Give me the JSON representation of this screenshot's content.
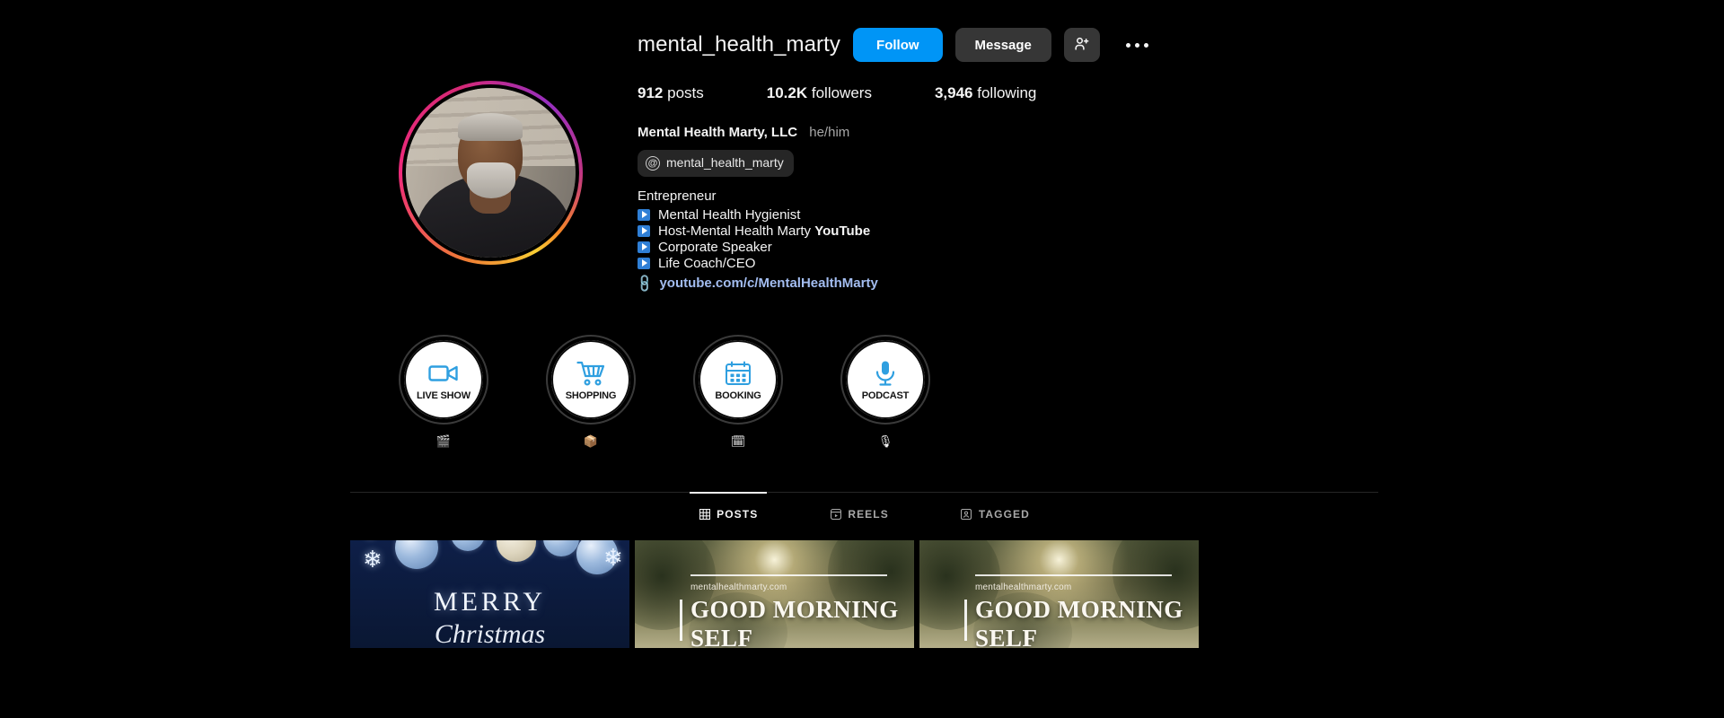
{
  "profile": {
    "username": "mental_health_marty",
    "avatar_alt": "profile-photo",
    "actions": {
      "follow_label": "Follow",
      "message_label": "Message",
      "add_person_icon": "person-add-icon",
      "more_options_icon": "more-options-icon"
    },
    "stats": [
      {
        "value": "912",
        "label": "posts"
      },
      {
        "value": "10.2K",
        "label": "followers"
      },
      {
        "value": "3,946",
        "label": "following"
      }
    ],
    "display_name": "Mental Health Marty, LLC",
    "pronouns": "he/him",
    "threads": {
      "icon": "threads-icon",
      "handle": "mental_health_marty"
    },
    "category": "Entrepreneur",
    "bio_lines": [
      {
        "icon": "play-button-emoji",
        "text": "Mental Health Hygienist",
        "bold_suffix": ""
      },
      {
        "icon": "play-button-emoji",
        "text": "Host-Mental Health Marty ",
        "bold_suffix": "YouTube"
      },
      {
        "icon": "play-button-emoji",
        "text": "Corporate Speaker",
        "bold_suffix": ""
      },
      {
        "icon": "play-button-emoji",
        "text": "Life Coach/CEO",
        "bold_suffix": ""
      }
    ],
    "link": {
      "icon": "link-chain-icon",
      "text": "youtube.com/c/MentalHealthMarty"
    }
  },
  "highlights": [
    {
      "cover_text": "LIVE SHOW",
      "icon": "video-camera-icon",
      "label": "🎬"
    },
    {
      "cover_text": "SHOPPING",
      "icon": "shopping-cart-icon",
      "label": "📦"
    },
    {
      "cover_text": "BOOKING",
      "icon": "calendar-icon",
      "label": "🗓"
    },
    {
      "cover_text": "PODCAST",
      "icon": "microphone-icon",
      "label": "🎙"
    }
  ],
  "tabs": [
    {
      "label": "POSTS",
      "icon": "grid-icon",
      "active": true
    },
    {
      "label": "REELS",
      "icon": "reels-icon",
      "active": false
    },
    {
      "label": "TAGGED",
      "icon": "tagged-icon",
      "active": false
    }
  ],
  "posts": [
    {
      "type": "xmas",
      "line1": "MERRY",
      "line2": "Christmas",
      "watermark": ""
    },
    {
      "type": "morning",
      "line1": "GOOD MORNING",
      "line2": "SELF",
      "watermark": "mentalhealthmarty.com"
    },
    {
      "type": "morning",
      "line1": "GOOD MORNING",
      "line2": "SELF",
      "watermark": "mentalhealthmarty.com"
    }
  ],
  "colors": {
    "background": "#000000",
    "follow_blue": "#0095f6",
    "button_gray": "#363636",
    "text_primary": "#f5f5f5",
    "text_secondary": "#a8a8a8",
    "link_blue": "#a3bdf0",
    "highlight_icon_blue": "#2f9fe0"
  }
}
